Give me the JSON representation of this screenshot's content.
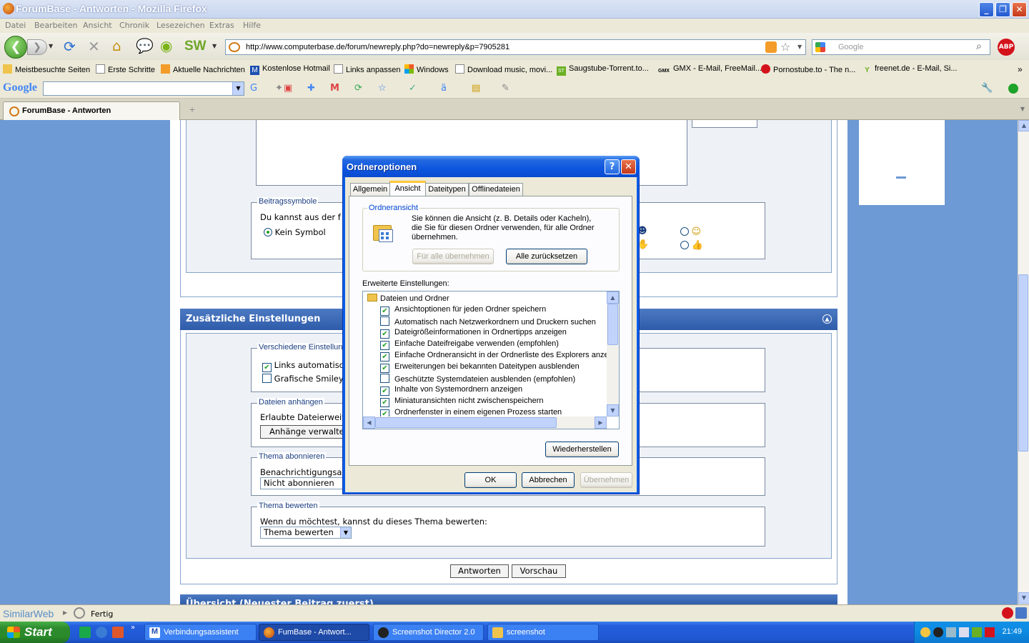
{
  "window": {
    "title": "ForumBase - Antworten - Mozilla Firefox"
  },
  "menu": [
    "Datei",
    "Bearbeiten",
    "Ansicht",
    "Chronik",
    "Lesezeichen",
    "Extras",
    "Hilfe"
  ],
  "nav": {
    "url": "http://www.computerbase.de/forum/newreply.php?do=newreply&p=7905281",
    "search_placeholder": "Google",
    "abp_label": "ABP"
  },
  "bookmarks": [
    "Meistbesuchte Seiten",
    "Erste Schritte",
    "Aktuelle Nachrichten",
    "Kostenlose Hotmail",
    "Links anpassen",
    "Windows",
    "Download music, movi...",
    "Saugstube-Torrent.to...",
    "GMX - E-Mail, FreeMail...",
    "Pornostube.to - The n...",
    "freenet.de - E-Mail, Si..."
  ],
  "google_toolbar": {
    "logo": "Google"
  },
  "tab": {
    "title": "ForumBase - Antworten"
  },
  "page": {
    "beitragssymbole": {
      "legend": "Beitragssymbole",
      "text": "Du kannst aus der f",
      "radio_label": "Kein Symbol"
    },
    "zusatz_header": "Zusätzliche Einstellungen",
    "verschiedene": {
      "legend": "Verschiedene Einstellung",
      "opt1": "Links automatisc",
      "opt2": "Grafische Smiley"
    },
    "dateien": {
      "legend": "Dateien anhängen",
      "text": "Erlaubte Dateierweit",
      "button": "Anhänge verwalte"
    },
    "abonnieren": {
      "legend": "Thema abonnieren",
      "text": "Benachrichtigungsar",
      "select": "Nicht abonnieren"
    },
    "bewerten": {
      "legend": "Thema bewerten",
      "text": "Wenn du möchtest, kannst du dieses Thema bewerten:",
      "select": "Thema bewerten"
    },
    "buttons": {
      "antworten": "Antworten",
      "vorschau": "Vorschau"
    },
    "uebersicht_header": "Übersicht (Neuester Beitrag zuerst)"
  },
  "dialog": {
    "title": "Ordneroptionen",
    "tabs": [
      "Allgemein",
      "Ansicht",
      "Dateitypen",
      "Offlinedateien"
    ],
    "ordneransicht": {
      "legend": "Ordneransicht",
      "text": "Sie können die Ansicht (z. B. Details oder Kacheln), die Sie für diesen Ordner verwenden, für alle Ordner übernehmen.",
      "btn_apply_all": "Für alle übernehmen",
      "btn_reset_all": "Alle zurücksetzen"
    },
    "advanced_label": "Erweiterte Einstellungen:",
    "list_root": "Dateien und Ordner",
    "list_items": [
      {
        "label": "Ansichtoptionen für jeden Ordner speichern",
        "checked": true
      },
      {
        "label": "Automatisch nach Netzwerkordnern und Druckern suchen",
        "checked": false
      },
      {
        "label": "Dateigrößeinformationen in Ordnertipps anzeigen",
        "checked": true
      },
      {
        "label": "Einfache Dateifreigabe verwenden (empfohlen)",
        "checked": true
      },
      {
        "label": "Einfache Ordneransicht in der Ordnerliste des Explorers anzeigen",
        "checked": true
      },
      {
        "label": "Erweiterungen bei bekannten Dateitypen ausblenden",
        "checked": true
      },
      {
        "label": "Geschützte Systemdateien ausblenden (empfohlen)",
        "checked": false
      },
      {
        "label": "Inhalte von Systemordnern anzeigen",
        "checked": true
      },
      {
        "label": "Miniaturansichten nicht zwischenspeichern",
        "checked": true
      },
      {
        "label": "Ordnerfenster in einem eigenen Prozess starten",
        "checked": true
      }
    ],
    "btn_restore": "Wiederherstellen",
    "btn_ok": "OK",
    "btn_cancel": "Abbrechen",
    "btn_apply": "Übernehmen"
  },
  "status": {
    "similarweb": "SimilarWeb",
    "text": "Fertig"
  },
  "taskbar": {
    "start": "Start",
    "tasks": [
      "Verbindungsassistent",
      "FumBase - Antwort...",
      "Screenshot Director 2.0",
      "screenshot"
    ],
    "clock": "21:49"
  },
  "colors": {
    "xp_blue": "#245edb",
    "forum_header": "#2f5ca9",
    "check_green": "#21a121"
  }
}
